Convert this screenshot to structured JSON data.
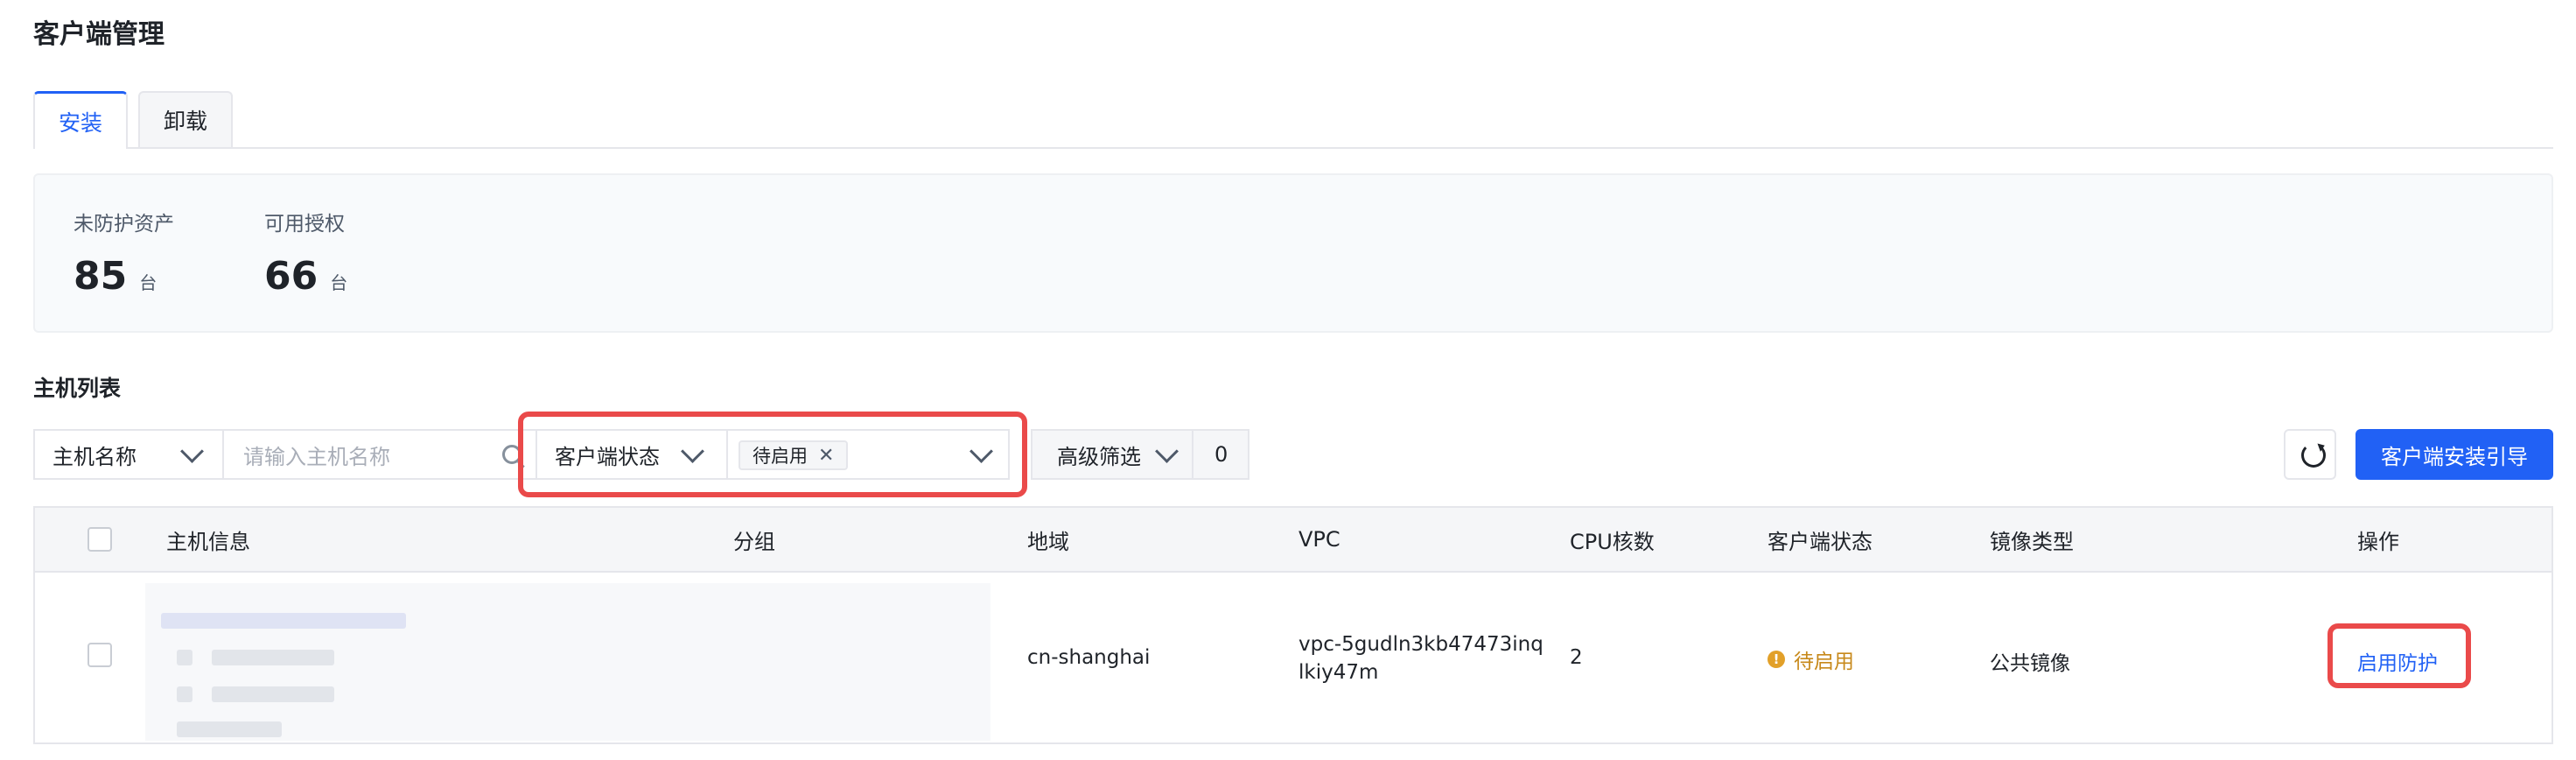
{
  "page": {
    "title": "客户端管理"
  },
  "tabs": [
    {
      "label": "安装",
      "active": true
    },
    {
      "label": "卸载",
      "active": false
    }
  ],
  "stats": [
    {
      "label": "未防护资产",
      "value": "85",
      "unit": "台"
    },
    {
      "label": "可用授权",
      "value": "66",
      "unit": "台"
    }
  ],
  "section": {
    "title": "主机列表"
  },
  "toolbar": {
    "field_select": "主机名称",
    "search_placeholder": "请输入主机名称",
    "status_filter_label": "客户端状态",
    "status_tag": "待启用",
    "advanced_filter_label": "高级筛选",
    "advanced_filter_count": "0",
    "install_guide_button": "客户端安装引导"
  },
  "table": {
    "columns": [
      "主机信息",
      "分组",
      "地域",
      "VPC",
      "CPU核数",
      "客户端状态",
      "镜像类型",
      "操作"
    ],
    "rows": [
      {
        "region": "cn-shanghai",
        "vpc_line1": "vpc-5gudln3kb47473inq",
        "vpc_line2": "lkiy47m",
        "cpu": "2",
        "status": "待启用",
        "image_type": "公共镜像",
        "action": "启用防护"
      }
    ]
  },
  "colors": {
    "primary": "#2161f5",
    "highlight": "#ea4a4a",
    "warning": "#e2a029"
  },
  "icons": [
    "chevron-down-icon",
    "search-icon",
    "close-icon",
    "refresh-icon",
    "warning-icon"
  ]
}
